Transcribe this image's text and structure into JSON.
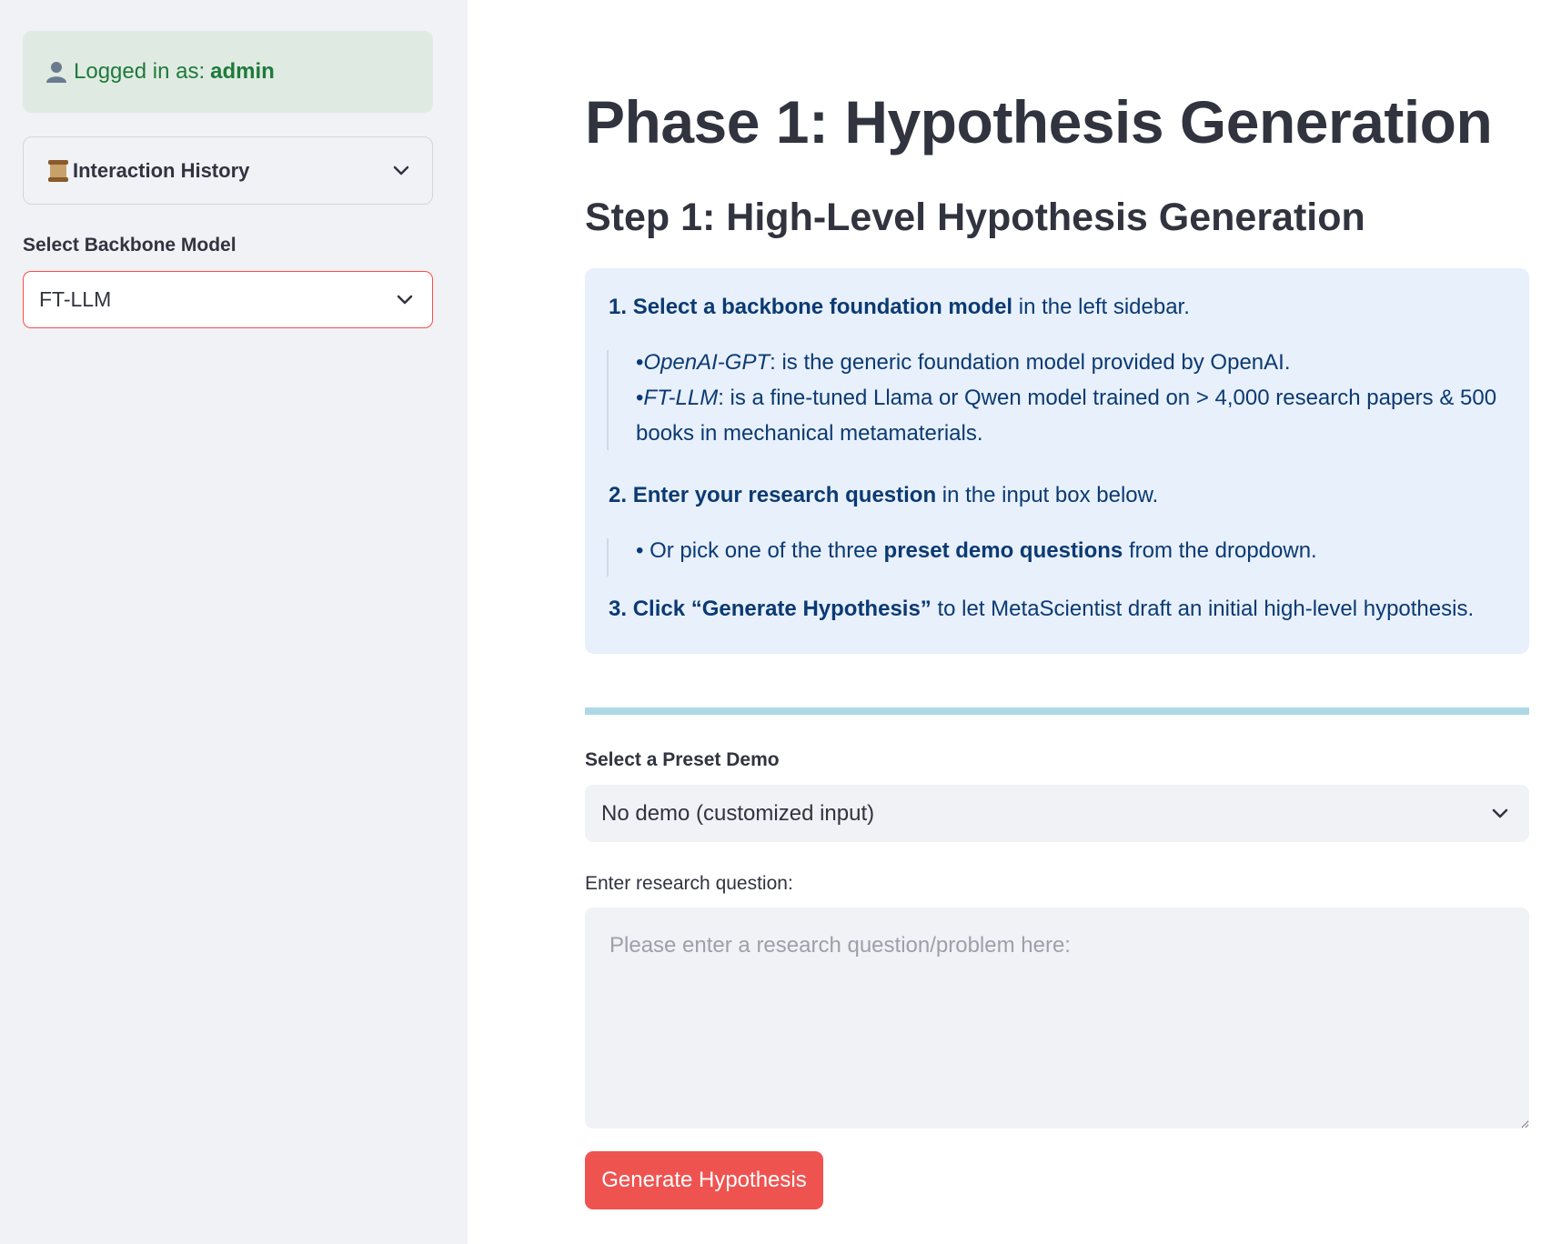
{
  "sidebar": {
    "login": {
      "prefix": "Logged in as:",
      "user": "admin"
    },
    "history": {
      "label": "Interaction History"
    },
    "model": {
      "label": "Select Backbone Model",
      "value": "FT-LLM"
    }
  },
  "main": {
    "title": "Phase 1: Hypothesis Generation",
    "subtitle": "Step 1: High-Level Hypothesis Generation",
    "instructions": {
      "step1": {
        "num": "1.",
        "bold": "Select a backbone foundation model",
        "rest": " in the left sidebar."
      },
      "step1_sub1": {
        "bullet": "•",
        "italic": "OpenAI-GPT",
        "rest": ": is the generic foundation model provided by OpenAI."
      },
      "step1_sub2": {
        "bullet": "•",
        "italic": "FT-LLM",
        "rest": ": is a fine-tuned Llama or Qwen model trained on > 4,000 research papers & 500",
        "rest2": "books in mechanical metamaterials."
      },
      "step2": {
        "num": "2.",
        "bold": "Enter your research question",
        "rest": " in the input box below."
      },
      "step2_sub1": {
        "bullet": "•",
        "pre": " Or pick one of the three ",
        "bold": "preset demo questions",
        "rest": " from the dropdown."
      },
      "step3": {
        "num": "3.",
        "bold": "Click “Generate Hypothesis”",
        "rest": " to let MetaScientist draft an initial high-level hypothesis."
      }
    },
    "demo": {
      "label": "Select a Preset Demo",
      "value": "No demo (customized input)"
    },
    "question": {
      "label": "Enter research question:",
      "placeholder": "Please enter a research question/problem here:"
    },
    "generate_label": "Generate Hypothesis"
  },
  "colors": {
    "accent": "#ff4b4b",
    "button": "#ef5350",
    "sidebar_bg": "#f0f2f6",
    "success_bg": "#dfebe2",
    "success_text": "#1f7a3b",
    "info_bg": "#e8f0fb",
    "info_text": "#0b3a73",
    "divider": "#add8e6"
  },
  "icons": {
    "user": "bust-in-silhouette-icon",
    "history": "scroll-icon",
    "dropdown": "chevron-down-icon"
  }
}
